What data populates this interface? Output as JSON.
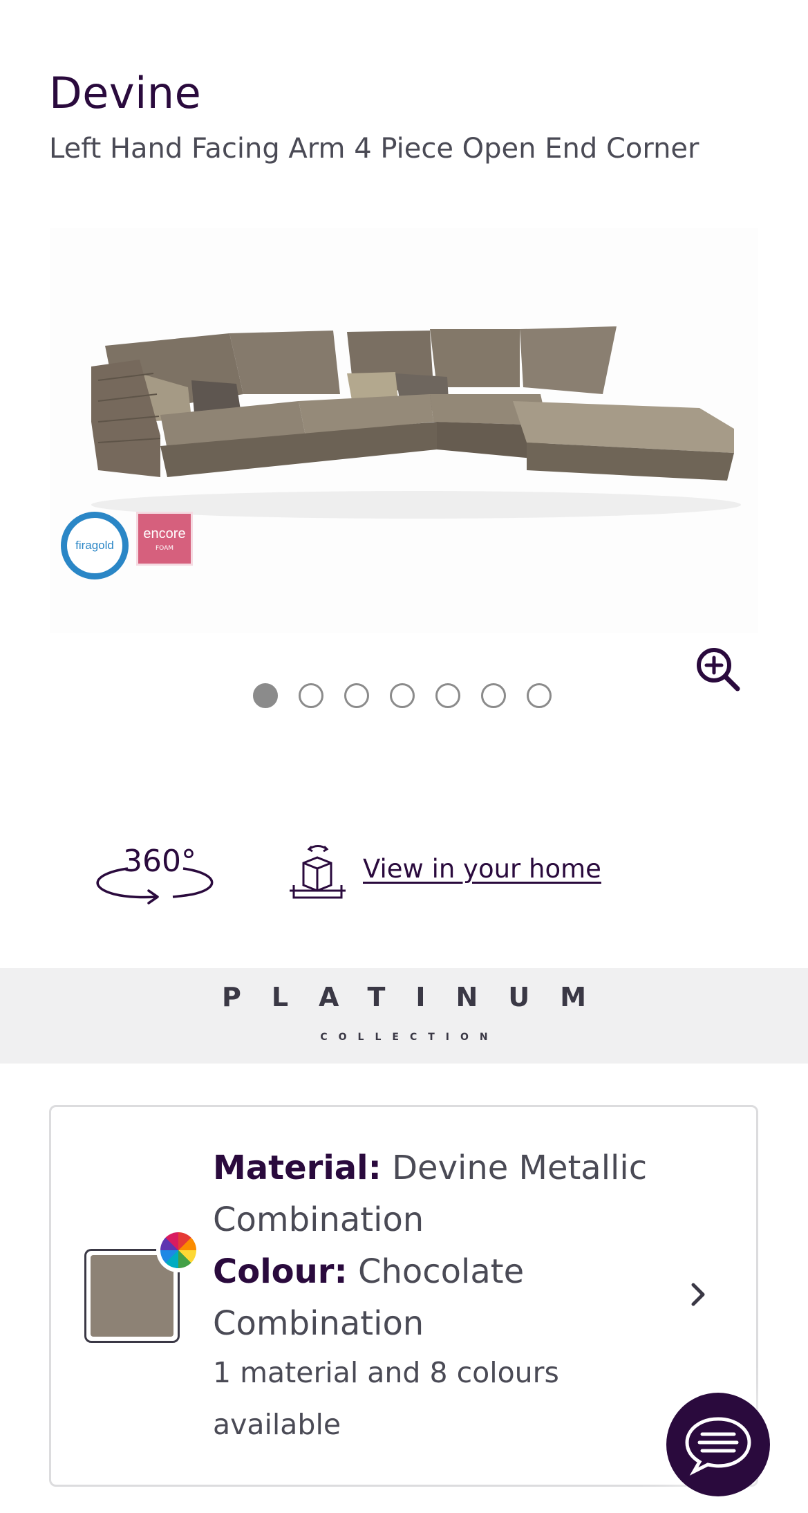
{
  "product": {
    "title": "Devine",
    "subtitle": "Left Hand Facing Arm 4 Piece Open End Corner"
  },
  "gallery": {
    "image_alt": "sofa-product-image",
    "badges": [
      {
        "name": "firagold",
        "text": "firagold"
      },
      {
        "name": "encore",
        "text": "encore",
        "sub": "FOAM"
      }
    ],
    "slide_count": 7,
    "active_slide": 1
  },
  "actions": {
    "view360_label": "360°",
    "ar_label": "View in your home"
  },
  "collection": {
    "brand": "PLATINUM",
    "subtitle": "COLLECTION"
  },
  "material_selector": {
    "material_label": "Material:",
    "material_value": "Devine Metallic Combination",
    "colour_label": "Colour:",
    "colour_value": "Chocolate Combination",
    "availability": "1 material and 8 colours available",
    "swatch_color": "#8d8275"
  },
  "colors": {
    "brand": "#2a0a3d",
    "text_muted": "#4a4a55",
    "band": "#f0f0f1"
  }
}
